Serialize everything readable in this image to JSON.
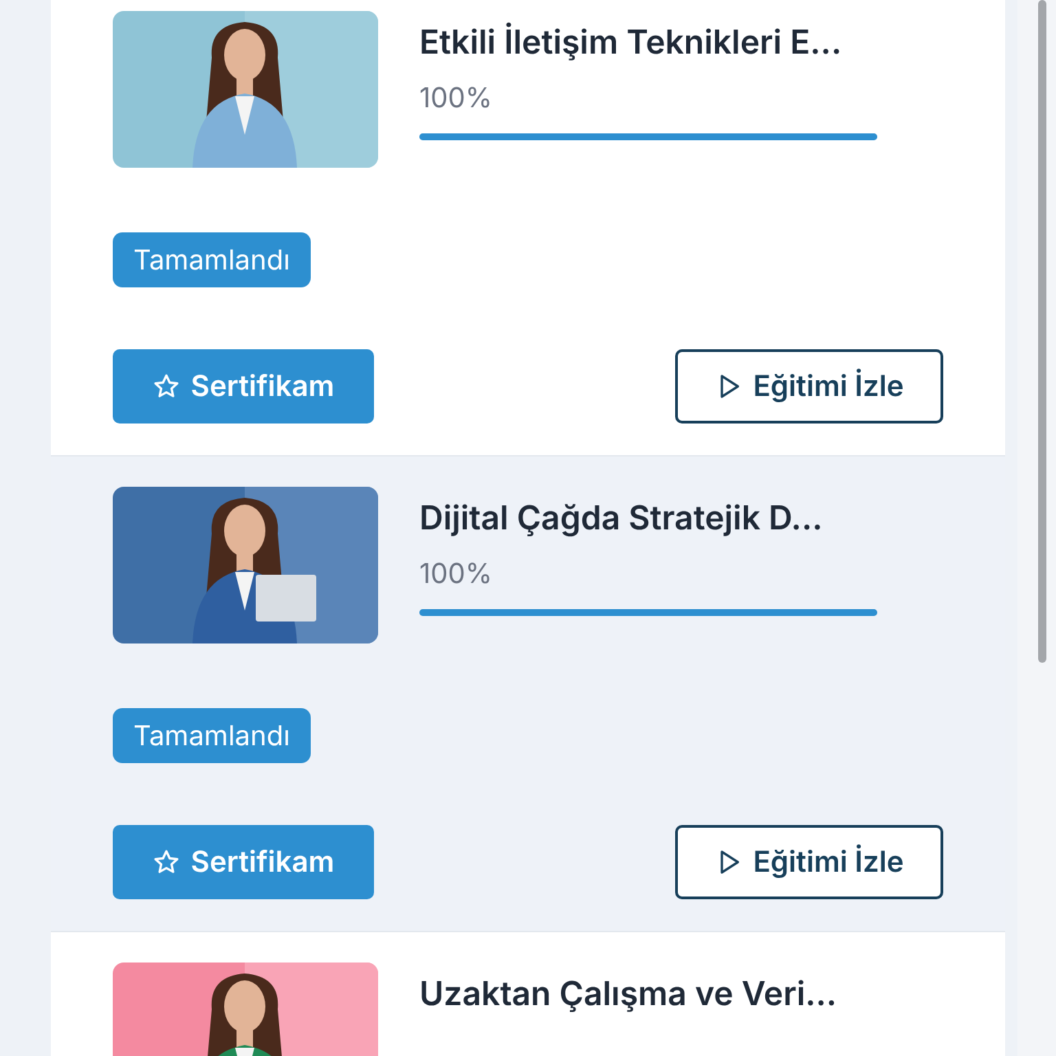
{
  "courses": [
    {
      "title": "Etkili İletişim Teknikleri E...",
      "percent": "100%",
      "level": 1,
      "badge": "Tamamlandı",
      "certificate_button": "Sertifikam",
      "watch_button": "Eğitimi İzle",
      "selected": false
    },
    {
      "title": "Dijital Çağda Stratejik D...",
      "percent": "100%",
      "level": 1,
      "badge": "Tamamlandı",
      "certificate_button": "Sertifikam",
      "watch_button": "Eğitimi İzle",
      "selected": true
    },
    {
      "title": "Uzaktan Çalışma ve Veri...",
      "selected": false
    }
  ]
}
